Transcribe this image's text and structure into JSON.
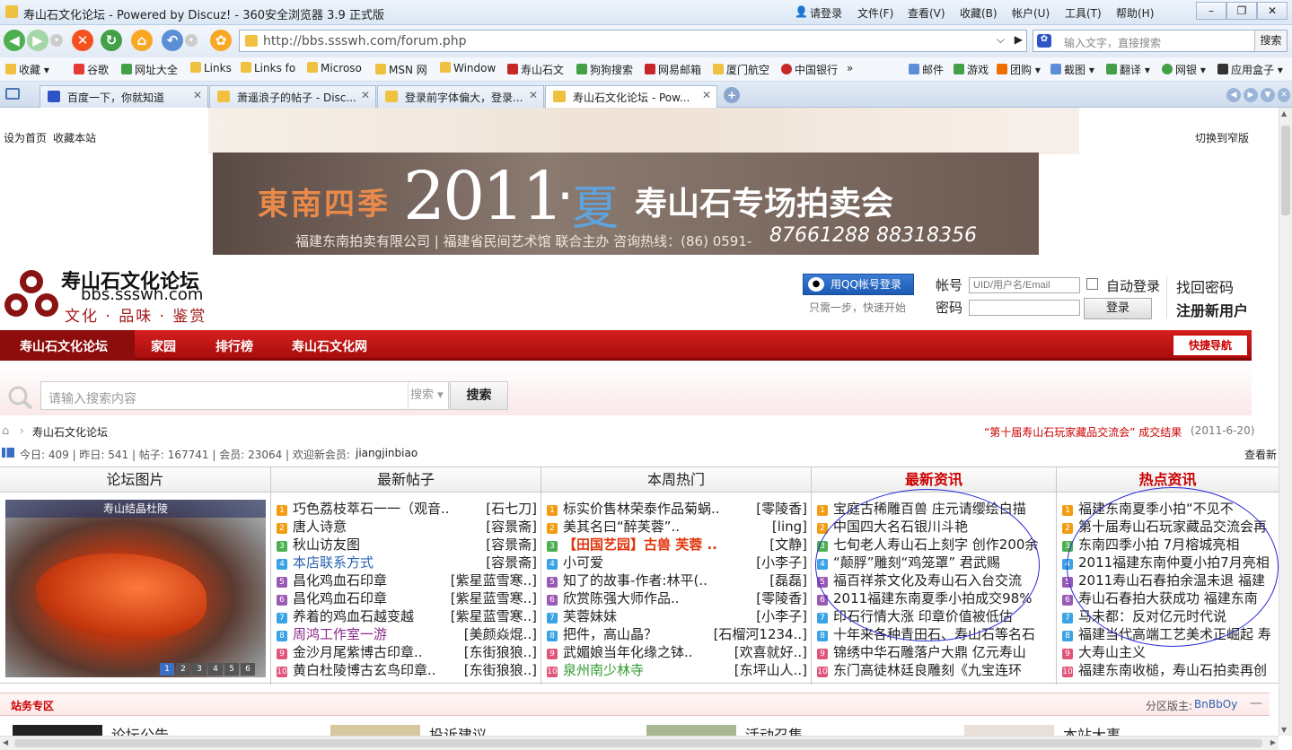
{
  "window": {
    "title": "寿山石文化论坛 - Powered by Discuz! - 360安全浏览器 3.9 正式版",
    "login": "请登录",
    "menus": [
      "文件(F)",
      "查看(V)",
      "收藏(B)",
      "帐户(U)",
      "工具(T)",
      "帮助(H)"
    ]
  },
  "addressbar": {
    "url": "http://bbs.ssswh.com/forum.php",
    "search_placeholder": "输入文字，直接搜索",
    "search_btn": "搜索"
  },
  "bookmarks": {
    "left": [
      "收藏",
      "谷歌",
      "网址大全",
      "Links",
      "Links fo",
      "Microso",
      "MSN 网",
      "Window",
      "寿山石文",
      "狗狗搜索",
      "网易邮箱",
      "厦门航空",
      "中国银行"
    ],
    "right": [
      "邮件",
      "游戏",
      "团购",
      "截图",
      "翻译",
      "网银",
      "应用盒子"
    ]
  },
  "tabs": [
    "百度一下，你就知道",
    "萧遥浪子的帖子 - Disc...",
    "登录前字体偏大，登录...",
    "寿山石文化论坛 - Pow..."
  ],
  "top": {
    "home": "设为首页",
    "fav": "收藏本站",
    "narrow": "切换到窄版"
  },
  "banner": {
    "l1": "東南四季",
    "year": "2011",
    "dot": "·",
    "season": "夏",
    "title": "寿山石专场拍卖会",
    "sub": "福建东南拍卖有限公司 | 福建省民间艺术馆  联合主办   咨询热线：(86) 0591-",
    "phone": "87661288  88318356"
  },
  "logo": {
    "name": "寿山石文化论坛",
    "domain": "bbs.ssswh.com",
    "slogan": "文化 · 品味 · 鉴赏"
  },
  "login": {
    "qq": "用QQ帐号登录",
    "qq_tip": "只需一步，快速开始",
    "user_label": "帐号",
    "user_ph": "UID/用户名/Email",
    "pass_label": "密码",
    "auto": "自动登录",
    "btn": "登录",
    "forgot": "找回密码",
    "reg": "注册新用户"
  },
  "nav": {
    "items": [
      "寿山石文化论坛",
      "家园",
      "排行榜",
      "寿山石文化网"
    ],
    "quick": "快捷导航"
  },
  "search": {
    "placeholder": "请输入搜索内容",
    "type": "搜索",
    "btn": "搜索"
  },
  "crumb": {
    "text": "寿山石文化论坛",
    "notice": "“第十届寿山石玩家藏品交流会” 成交结果",
    "date": "(2011-6-20)"
  },
  "stats": {
    "text": "今日: 409 | 昨日: 541 | 帖子: 167741 | 会员: 23064 | 欢迎新会员: ",
    "user": "jiangjinbiao",
    "more": "查看新"
  },
  "columns": {
    "pics": {
      "title": "论坛图片",
      "caption": "寿山结晶杜陵",
      "pages": [
        "1",
        "2",
        "3",
        "4",
        "5",
        "6"
      ]
    },
    "newposts": {
      "title": "最新帖子",
      "rows": [
        [
          "巧色荔枝萃石一一（观音..",
          "[石七刀]"
        ],
        [
          "唐人诗意",
          "[容景斋]"
        ],
        [
          "秋山访友图",
          "[容景斋]"
        ],
        [
          "本店联系方式",
          "[容景斋]"
        ],
        [
          "昌化鸡血石印章",
          "[紫星蓝雪寒..]"
        ],
        [
          "昌化鸡血石印章",
          "[紫星蓝雪寒..]"
        ],
        [
          "养着的鸡血石越变越",
          "[紫星蓝雪寒..]"
        ],
        [
          "周鸿工作室一游",
          "[美颜焱焜..]"
        ],
        [
          "金沙月尾紫博古印章..",
          "[东街狼狼..]"
        ],
        [
          "黄白杜陵博古玄鸟印章..",
          "[东街狼狼..]"
        ]
      ]
    },
    "hot": {
      "title": "本周热门",
      "rows": [
        [
          "标实价售林荣泰作品菊蜗..",
          "[零陵香]"
        ],
        [
          "美其名曰“醉芙蓉”..",
          "[ling]"
        ],
        [
          "【田国艺园】古兽  芙蓉 ..",
          "[文静]"
        ],
        [
          "小可爱",
          "[小李子]"
        ],
        [
          "知了的故事-作者:林平(..",
          "[磊磊]"
        ],
        [
          "欣赏陈强大师作品..",
          "[零陵香]"
        ],
        [
          "芙蓉妹妹",
          "[小李子]"
        ],
        [
          "把件，高山晶？",
          "[石榴河1234..]"
        ],
        [
          "武媚娘当年化缘之钵..",
          "[欢喜就好..]"
        ],
        [
          "泉州南少林寺",
          "[东坪山人..]"
        ]
      ]
    },
    "news": {
      "title": "最新资讯",
      "rows": [
        "宝庭古稀雕百兽   庄元请缨绘白描",
        "中国四大名石银川斗艳",
        "七旬老人寿山石上刻字 创作200余",
        "“颠脬”雕刻“鸡笼罩”   君武赐",
        "福百祥茶文化及寿山石入台交流",
        "2011福建东南夏季小拍成交98%",
        "印石行情大涨  印章价值被低估",
        "十年来各种青田石、寿山石等名石",
        "锦绣中华石雕落户大鼎 亿元寿山",
        "东门高徒林廷良雕刻《九宝连环"
      ]
    },
    "hotnews": {
      "title": "热点资讯",
      "rows": [
        "福建东南夏季小拍“不见不",
        "第十届寿山石玩家藏品交流会再",
        "东南四季小拍  7月榕城亮相",
        "2011福建东南仲夏小拍7月亮相",
        "2011寿山石春拍余温未退 福建",
        "寿山石春拍大获成功 福建东南",
        "马未都：反对亿元时代说",
        "福建当代高端工艺美术正崛起 寿",
        "大寿山主义",
        "福建东南收槌，寿山石拍卖再创"
      ]
    }
  },
  "zone": {
    "title": "站务专区",
    "mod_label": "分区版主:",
    "mod": "BnBbOy"
  },
  "bottom": [
    "论坛公告",
    "投诉建议",
    "活动召集",
    "本站大事"
  ],
  "colors": {
    "nav": "#c41a1a",
    "accent": "#cc0000",
    "link": "#2a63b0"
  }
}
